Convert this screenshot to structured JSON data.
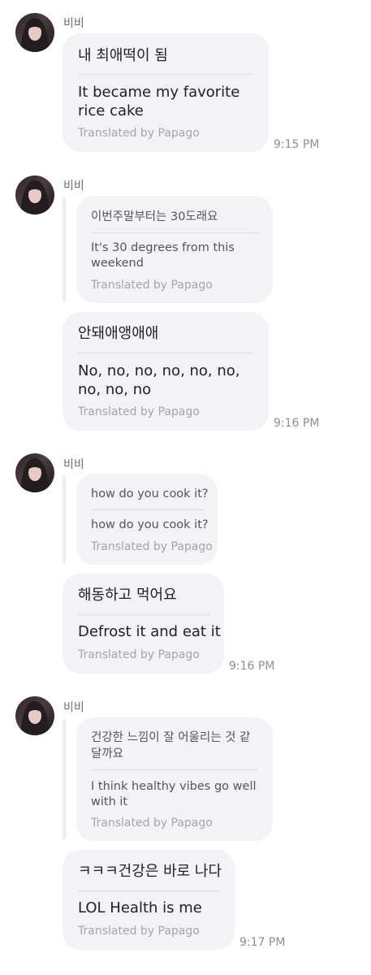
{
  "chat": {
    "translator_credit": "Translated by Papago",
    "groups": [
      {
        "sender": "비비",
        "time": "9:15 PM",
        "messages": [
          {
            "original": "내 최애떡이 됨",
            "translation": "It became my favorite rice cake"
          }
        ]
      },
      {
        "sender": "비비",
        "time": "9:16 PM",
        "quote": {
          "original": "이번주말부터는 30도래요",
          "translation": "It's 30 degrees from this weekend"
        },
        "messages": [
          {
            "original": "안돼애앵애애",
            "translation": "No, no, no, no, no, no, no, no, no"
          }
        ]
      },
      {
        "sender": "비비",
        "time": "9:16 PM",
        "quote": {
          "original": "how do you cook it?",
          "translation": "how do you cook it?"
        },
        "messages": [
          {
            "original": "해동하고 먹어요",
            "translation": "Defrost it and eat it"
          }
        ]
      },
      {
        "sender": "비비",
        "time": "9:17 PM",
        "quote": {
          "original": "건강한 느낌이 잘 어울리는 것 같달까요",
          "translation": "I think healthy vibes go well with it"
        },
        "messages": [
          {
            "original": "ㅋㅋㅋ건강은 바로 나다",
            "translation": "LOL Health is me"
          }
        ]
      }
    ]
  }
}
